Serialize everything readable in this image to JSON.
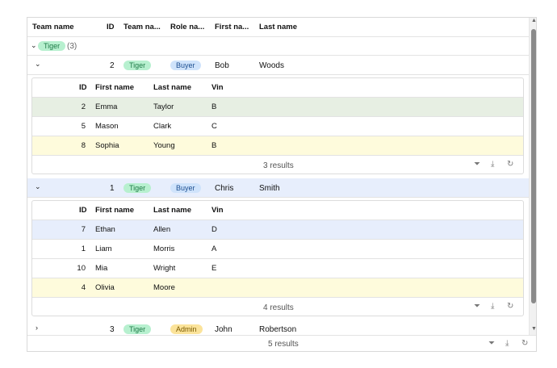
{
  "header": {
    "columns": [
      "Team name",
      "ID",
      "Team na...",
      "Role na...",
      "First na...",
      "Last name"
    ]
  },
  "group": {
    "label": "Tiger",
    "count": "(3)"
  },
  "rows": [
    {
      "id": "2",
      "team": "Tiger",
      "role": "Buyer",
      "first": "Bob",
      "last": "Woods",
      "expanded": true,
      "detail": {
        "columns": [
          "ID",
          "First name",
          "Last name",
          "Vin"
        ],
        "rows": [
          {
            "id": "2",
            "first": "Emma",
            "last": "Taylor",
            "vin": "B"
          },
          {
            "id": "5",
            "first": "Mason",
            "last": "Clark",
            "vin": "C"
          },
          {
            "id": "8",
            "first": "Sophia",
            "last": "Young",
            "vin": "B"
          }
        ],
        "footer": "3 results"
      }
    },
    {
      "id": "1",
      "team": "Tiger",
      "role": "Buyer",
      "first": "Chris",
      "last": "Smith",
      "expanded": true,
      "detail": {
        "columns": [
          "ID",
          "First name",
          "Last name",
          "Vin"
        ],
        "rows": [
          {
            "id": "7",
            "first": "Ethan",
            "last": "Allen",
            "vin": "D"
          },
          {
            "id": "1",
            "first": "Liam",
            "last": "Morris",
            "vin": "A"
          },
          {
            "id": "10",
            "first": "Mia",
            "last": "Wright",
            "vin": "E"
          },
          {
            "id": "4",
            "first": "Olivia",
            "last": "Moore",
            "vin": ""
          }
        ],
        "footer": "4 results"
      }
    },
    {
      "id": "3",
      "team": "Tiger",
      "role": "Admin",
      "first": "John",
      "last": "Robertson",
      "expanded": false
    }
  ],
  "footer": "5 results",
  "colors": {
    "tiger_pill": "#b7f0cf",
    "tiger_text": "#1e7a47",
    "buyer_pill": "#cfe3fb",
    "buyer_text": "#1d4f91",
    "admin_pill": "#fbe39a",
    "admin_text": "#7a5a00",
    "row_green": "#e7efe3",
    "row_yellow": "#fefbdc",
    "row_blue": "#e7eefc"
  },
  "icons": [
    "chevron-down-icon",
    "chevron-right-icon",
    "filter-icon",
    "download-icon",
    "reset-icon",
    "scroll-up-icon",
    "scroll-down-icon"
  ]
}
